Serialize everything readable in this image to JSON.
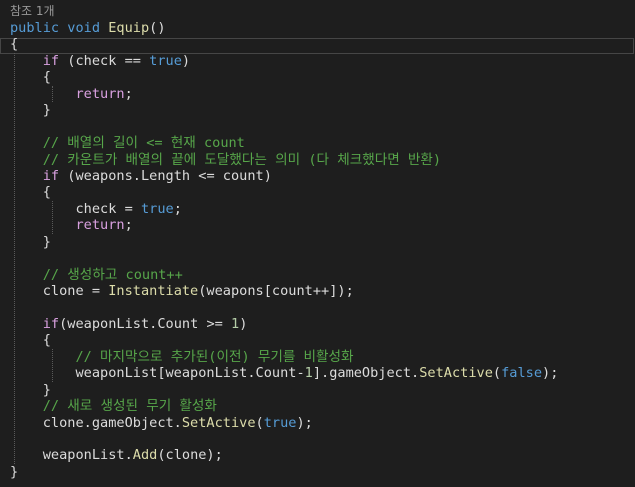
{
  "codelens": "참조 1개",
  "lines": [
    [
      {
        "t": "public",
        "c": "kw"
      },
      {
        "t": " ",
        "c": "pl"
      },
      {
        "t": "void",
        "c": "kw"
      },
      {
        "t": " ",
        "c": "pl"
      },
      {
        "t": "Equip",
        "c": "m"
      },
      {
        "t": "()",
        "c": "pl"
      }
    ],
    [
      {
        "t": "{",
        "c": "pl"
      }
    ],
    [
      {
        "t": "    ",
        "c": "pl"
      },
      {
        "t": "if",
        "c": "ctl"
      },
      {
        "t": " (check == ",
        "c": "pl"
      },
      {
        "t": "true",
        "c": "kw"
      },
      {
        "t": ")",
        "c": "pl"
      }
    ],
    [
      {
        "t": "    {",
        "c": "pl"
      }
    ],
    [
      {
        "t": "        ",
        "c": "pl"
      },
      {
        "t": "return",
        "c": "ctl"
      },
      {
        "t": ";",
        "c": "pl"
      }
    ],
    [
      {
        "t": "    }",
        "c": "pl"
      }
    ],
    [
      {
        "t": "",
        "c": "pl"
      }
    ],
    [
      {
        "t": "    ",
        "c": "pl"
      },
      {
        "t": "// 배열의 길이 <= 현재 count",
        "c": "cm"
      }
    ],
    [
      {
        "t": "    ",
        "c": "pl"
      },
      {
        "t": "// 카운트가 배열의 끝에 도달했다는 의미 (다 체크했다면 반환)",
        "c": "cm"
      }
    ],
    [
      {
        "t": "    ",
        "c": "pl"
      },
      {
        "t": "if",
        "c": "ctl"
      },
      {
        "t": " (weapons.Length <= count)",
        "c": "pl"
      }
    ],
    [
      {
        "t": "    {",
        "c": "pl"
      }
    ],
    [
      {
        "t": "        check = ",
        "c": "pl"
      },
      {
        "t": "true",
        "c": "kw"
      },
      {
        "t": ";",
        "c": "pl"
      }
    ],
    [
      {
        "t": "        ",
        "c": "pl"
      },
      {
        "t": "return",
        "c": "ctl"
      },
      {
        "t": ";",
        "c": "pl"
      }
    ],
    [
      {
        "t": "    }",
        "c": "pl"
      }
    ],
    [
      {
        "t": "",
        "c": "pl"
      }
    ],
    [
      {
        "t": "    ",
        "c": "pl"
      },
      {
        "t": "// 생성하고 count++",
        "c": "cm"
      }
    ],
    [
      {
        "t": "    clone = ",
        "c": "pl"
      },
      {
        "t": "Instantiate",
        "c": "m"
      },
      {
        "t": "(weapons[count++]);",
        "c": "pl"
      }
    ],
    [
      {
        "t": "",
        "c": "pl"
      }
    ],
    [
      {
        "t": "    ",
        "c": "pl"
      },
      {
        "t": "if",
        "c": "ctl"
      },
      {
        "t": "(weaponList.Count >= ",
        "c": "pl"
      },
      {
        "t": "1",
        "c": "num"
      },
      {
        "t": ")",
        "c": "pl"
      }
    ],
    [
      {
        "t": "    {",
        "c": "pl"
      }
    ],
    [
      {
        "t": "        ",
        "c": "pl"
      },
      {
        "t": "// 마지막으로 추가된(이전) 무기를 비활성화",
        "c": "cm"
      }
    ],
    [
      {
        "t": "        weaponList[weaponList.Count-",
        "c": "pl"
      },
      {
        "t": "1",
        "c": "num"
      },
      {
        "t": "].gameObject.",
        "c": "pl"
      },
      {
        "t": "SetActive",
        "c": "m"
      },
      {
        "t": "(",
        "c": "pl"
      },
      {
        "t": "false",
        "c": "kw"
      },
      {
        "t": ");",
        "c": "pl"
      }
    ],
    [
      {
        "t": "    }",
        "c": "pl"
      }
    ],
    [
      {
        "t": "    ",
        "c": "pl"
      },
      {
        "t": "// 새로 생성된 무기 활성화",
        "c": "cm"
      }
    ],
    [
      {
        "t": "    clone.gameObject.",
        "c": "pl"
      },
      {
        "t": "SetActive",
        "c": "m"
      },
      {
        "t": "(",
        "c": "pl"
      },
      {
        "t": "true",
        "c": "kw"
      },
      {
        "t": ");",
        "c": "pl"
      }
    ],
    [
      {
        "t": "",
        "c": "pl"
      }
    ],
    [
      {
        "t": "    weaponList.",
        "c": "pl"
      },
      {
        "t": "Add",
        "c": "m"
      },
      {
        "t": "(clone);",
        "c": "pl"
      }
    ],
    [
      {
        "t": "}",
        "c": "pl"
      }
    ]
  ]
}
